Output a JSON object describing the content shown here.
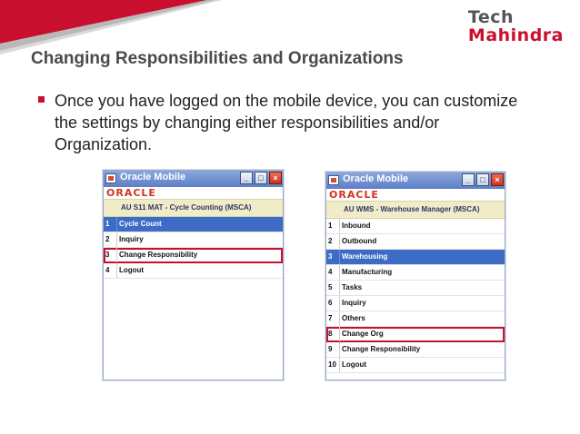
{
  "logo": {
    "line1": "Tech",
    "line2": "Mahindra"
  },
  "title": "Changing Responsibilities and Organizations",
  "bullet_text": "Once you have logged on the mobile device, you can customize the settings by changing either responsibilities and/or Organization.",
  "colors": {
    "brand_red": "#c8102e",
    "selection_blue": "#3d6cc7",
    "resp_bar": "#f1ecc8",
    "oracle_red": "#d5341f"
  },
  "window_left": {
    "title": "Oracle Mobile",
    "logo_text": "ORACLE",
    "responsibility": "AU S11 MAT - Cycle Counting (MSCA)",
    "controls": {
      "minimize": "_",
      "maximize": "□",
      "close": "×"
    },
    "items": [
      {
        "num": "1",
        "label": "Cycle Count",
        "selected": true,
        "highlighted": false
      },
      {
        "num": "2",
        "label": "Inquiry",
        "selected": false,
        "highlighted": false
      },
      {
        "num": "3",
        "label": "Change Responsibility",
        "selected": false,
        "highlighted": true
      },
      {
        "num": "4",
        "label": "Logout",
        "selected": false,
        "highlighted": false
      }
    ]
  },
  "window_right": {
    "title": "Oracle Mobile",
    "logo_text": "ORACLE",
    "responsibility": "AU WMS - Warehouse Manager (MSCA)",
    "controls": {
      "minimize": "_",
      "maximize": "□",
      "close": "×"
    },
    "items": [
      {
        "num": "1",
        "label": "Inbound",
        "selected": false,
        "highlighted": false
      },
      {
        "num": "2",
        "label": "Outbound",
        "selected": false,
        "highlighted": false
      },
      {
        "num": "3",
        "label": "Warehousing",
        "selected": true,
        "highlighted": false
      },
      {
        "num": "4",
        "label": "Manufacturing",
        "selected": false,
        "highlighted": false
      },
      {
        "num": "5",
        "label": "Tasks",
        "selected": false,
        "highlighted": false
      },
      {
        "num": "6",
        "label": "Inquiry",
        "selected": false,
        "highlighted": false
      },
      {
        "num": "7",
        "label": "Others",
        "selected": false,
        "highlighted": false
      },
      {
        "num": "8",
        "label": "Change Org",
        "selected": false,
        "highlighted": true
      },
      {
        "num": "9",
        "label": "Change Responsibility",
        "selected": false,
        "highlighted": false
      },
      {
        "num": "10",
        "label": "Logout",
        "selected": false,
        "highlighted": false
      }
    ]
  }
}
